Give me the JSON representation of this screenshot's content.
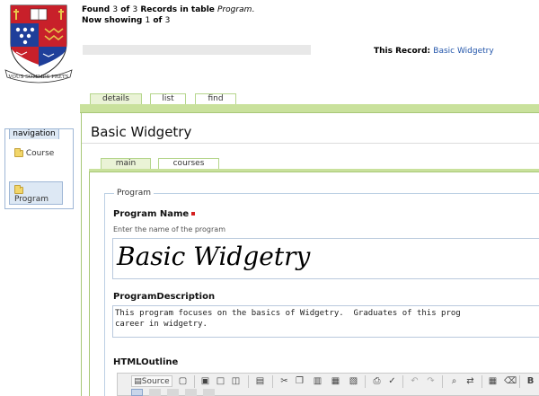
{
  "header": {
    "found_prefix": "Found ",
    "found_count": "3",
    "found_of": " of ",
    "found_total": "3",
    "found_suffix": " Records in table ",
    "table_name": "Program",
    "table_period": ".",
    "showing_prefix": "Now showing ",
    "showing_current": "1",
    "showing_of": " of ",
    "showing_total": "3",
    "record_label": "This Record:",
    "record_link": "Basic Widgetry",
    "crest_motto": "VOUS SOMMES PRETS"
  },
  "tabs": [
    {
      "label": "details",
      "active": true
    },
    {
      "label": "list",
      "active": false
    },
    {
      "label": "find",
      "active": false
    }
  ],
  "navigation": {
    "title": "navigation",
    "items": [
      {
        "label": "Course",
        "selected": false
      },
      {
        "label": "Program",
        "selected": true
      }
    ]
  },
  "record": {
    "title": "Basic Widgetry"
  },
  "subtabs": [
    {
      "label": "main",
      "active": true
    },
    {
      "label": "courses",
      "active": false
    }
  ],
  "form": {
    "legend": "Program",
    "program_name_label": "Program Name",
    "program_name_hint": "Enter the name of the program",
    "program_name_value": "Basic Widgetry",
    "description_label": "ProgramDescription",
    "description_value": "This program focuses on the basics of Widgetry.  Graduates of this prog\ncareer in widgetry.",
    "outline_label": "HTMLOutline"
  },
  "editor_toolbar": {
    "source_label": "Source",
    "icons": [
      "source-icon",
      "new-page-icon",
      "save-icon",
      "template-icon",
      "preview-icon",
      "paste-text-icon",
      "cut-icon",
      "copy-icon",
      "paste-icon",
      "paste-word-icon",
      "print-icon",
      "spellcheck-icon",
      "undo-icon",
      "redo-icon",
      "find-icon",
      "replace-icon",
      "select-all-icon",
      "remove-format-icon",
      "bold-icon"
    ]
  },
  "colors": {
    "tab_green": "#c9e19c",
    "tab_border": "#a8c878",
    "nav_blue": "#dde8f4",
    "link_blue": "#2255aa",
    "required_red": "#d42020"
  }
}
